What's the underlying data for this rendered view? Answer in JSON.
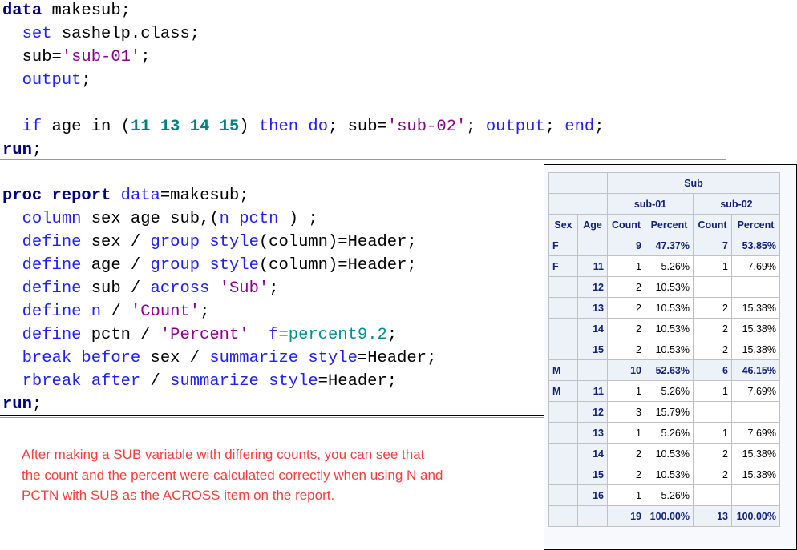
{
  "code": {
    "data_step": [
      [
        [
          "data",
          "kw"
        ],
        [
          " makesub;",
          "p"
        ]
      ],
      [
        [
          "  ",
          "p"
        ],
        [
          "set",
          "blue"
        ],
        [
          " sashelp.class;",
          "p"
        ]
      ],
      [
        [
          "  sub=",
          "p"
        ],
        [
          "'sub-01'",
          "str"
        ],
        [
          ";",
          "p"
        ]
      ],
      [
        [
          "  ",
          "p"
        ],
        [
          "output",
          "blue"
        ],
        [
          ";",
          "p"
        ]
      ],
      [
        [
          "",
          "p"
        ]
      ],
      [
        [
          "  ",
          "p"
        ],
        [
          "if",
          "blue"
        ],
        [
          " age in (",
          "p"
        ],
        [
          "11 13 14 15",
          "num"
        ],
        [
          ") ",
          "p"
        ],
        [
          "then",
          "blue"
        ],
        [
          " ",
          "p"
        ],
        [
          "do",
          "blue"
        ],
        [
          "; sub=",
          "p"
        ],
        [
          "'sub-02'",
          "str"
        ],
        [
          "; ",
          "p"
        ],
        [
          "output",
          "blue"
        ],
        [
          "; ",
          "p"
        ],
        [
          "end",
          "blue"
        ],
        [
          ";",
          "p"
        ]
      ],
      [
        [
          "run",
          "kw"
        ],
        [
          ";",
          "p"
        ]
      ]
    ],
    "proc_step": [
      [
        [
          "proc report",
          "kw"
        ],
        [
          " ",
          "p"
        ],
        [
          "data",
          "blue"
        ],
        [
          "=makesub;",
          "p"
        ]
      ],
      [
        [
          "  ",
          "p"
        ],
        [
          "column",
          "blue"
        ],
        [
          " sex age sub,(",
          "p"
        ],
        [
          "n pctn",
          "blue"
        ],
        [
          " ) ;",
          "p"
        ]
      ],
      [
        [
          "  ",
          "p"
        ],
        [
          "define",
          "blue"
        ],
        [
          " sex / ",
          "p"
        ],
        [
          "group style",
          "blue"
        ],
        [
          "(column)=Header;",
          "p"
        ]
      ],
      [
        [
          "  ",
          "p"
        ],
        [
          "define",
          "blue"
        ],
        [
          " age / ",
          "p"
        ],
        [
          "group style",
          "blue"
        ],
        [
          "(column)=Header;",
          "p"
        ]
      ],
      [
        [
          "  ",
          "p"
        ],
        [
          "define",
          "blue"
        ],
        [
          " sub / ",
          "p"
        ],
        [
          "across",
          "blue"
        ],
        [
          " ",
          "p"
        ],
        [
          "'Sub'",
          "str"
        ],
        [
          ";",
          "p"
        ]
      ],
      [
        [
          "  ",
          "p"
        ],
        [
          "define",
          "blue"
        ],
        [
          " ",
          "p"
        ],
        [
          "n",
          "blue"
        ],
        [
          " / ",
          "p"
        ],
        [
          "'Count'",
          "str"
        ],
        [
          ";",
          "p"
        ]
      ],
      [
        [
          "  ",
          "p"
        ],
        [
          "define",
          "blue"
        ],
        [
          " pctn / ",
          "p"
        ],
        [
          "'Percent'",
          "str"
        ],
        [
          "  ",
          "p"
        ],
        [
          "f=",
          "blue"
        ],
        [
          "percent9.2",
          "fmt"
        ],
        [
          ";",
          "p"
        ]
      ],
      [
        [
          "  ",
          "p"
        ],
        [
          "break before",
          "blue"
        ],
        [
          " sex / ",
          "p"
        ],
        [
          "summarize style",
          "blue"
        ],
        [
          "=Header;",
          "p"
        ]
      ],
      [
        [
          "  ",
          "p"
        ],
        [
          "rbreak after",
          "blue"
        ],
        [
          " / ",
          "p"
        ],
        [
          "summarize style",
          "blue"
        ],
        [
          "=Header;",
          "p"
        ]
      ],
      [
        [
          "run",
          "kw"
        ],
        [
          ";",
          "p"
        ]
      ]
    ]
  },
  "note": [
    "After making a SUB variable with differing counts, you can see that",
    "the count and the percent were calculated correctly when using N and",
    "PCTN with SUB as the ACROSS item on the report."
  ],
  "report": {
    "across_label": "Sub",
    "groups": [
      "sub-01",
      "sub-02"
    ],
    "columns": [
      "Sex",
      "Age",
      "Count",
      "Percent",
      "Count",
      "Percent"
    ],
    "rows": [
      {
        "sum": true,
        "cells": [
          "F",
          "",
          "9",
          "47.37%",
          "7",
          "53.85%"
        ]
      },
      {
        "sum": false,
        "cells": [
          "F",
          "11",
          "1",
          "5.26%",
          "1",
          "7.69%"
        ]
      },
      {
        "sum": false,
        "cells": [
          "",
          "12",
          "2",
          "10.53%",
          "",
          ""
        ]
      },
      {
        "sum": false,
        "cells": [
          "",
          "13",
          "2",
          "10.53%",
          "2",
          "15.38%"
        ]
      },
      {
        "sum": false,
        "cells": [
          "",
          "14",
          "2",
          "10.53%",
          "2",
          "15.38%"
        ]
      },
      {
        "sum": false,
        "cells": [
          "",
          "15",
          "2",
          "10.53%",
          "2",
          "15.38%"
        ]
      },
      {
        "sum": true,
        "cells": [
          "M",
          "",
          "10",
          "52.63%",
          "6",
          "46.15%"
        ]
      },
      {
        "sum": false,
        "cells": [
          "M",
          "11",
          "1",
          "5.26%",
          "1",
          "7.69%"
        ]
      },
      {
        "sum": false,
        "cells": [
          "",
          "12",
          "3",
          "15.79%",
          "",
          ""
        ]
      },
      {
        "sum": false,
        "cells": [
          "",
          "13",
          "1",
          "5.26%",
          "1",
          "7.69%"
        ]
      },
      {
        "sum": false,
        "cells": [
          "",
          "14",
          "2",
          "10.53%",
          "2",
          "15.38%"
        ]
      },
      {
        "sum": false,
        "cells": [
          "",
          "15",
          "2",
          "10.53%",
          "2",
          "15.38%"
        ]
      },
      {
        "sum": false,
        "cells": [
          "",
          "16",
          "1",
          "5.26%",
          "",
          ""
        ]
      },
      {
        "sum": true,
        "cells": [
          "",
          "",
          "19",
          "100.00%",
          "13",
          "100.00%"
        ]
      }
    ]
  }
}
